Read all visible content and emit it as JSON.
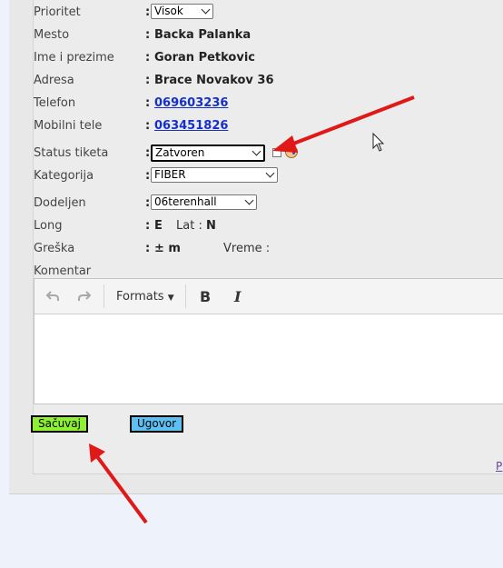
{
  "form": {
    "prioritet": {
      "label": "Prioritet",
      "value": "Visok"
    },
    "mesto": {
      "label": "Mesto",
      "value": "Backa Palanka"
    },
    "ime": {
      "label": "Ime i prezime",
      "value": "Goran Petkovic"
    },
    "adresa": {
      "label": "Adresa",
      "value": "Brace Novakov 36"
    },
    "telefon": {
      "label": "Telefon",
      "value": "069603236"
    },
    "mobilni": {
      "label": "Mobilni tele",
      "value": "063451826"
    },
    "status": {
      "label": "Status tiketa",
      "value": "Zatvoren"
    },
    "kategorija": {
      "label": "Kategorija",
      "value": "FIBER"
    },
    "dodeljen": {
      "label": "Dodeljen",
      "value": "06terenhall"
    },
    "long": {
      "label": "Long",
      "value": "E",
      "lat_label": "Lat :",
      "lat_value": "N"
    },
    "greska": {
      "label": "Greška",
      "value": "± m",
      "vreme_label": "Vreme :"
    },
    "komentar": {
      "label": "Komentar"
    },
    "colon": ":"
  },
  "editor": {
    "undo_icon": "undo-icon",
    "redo_icon": "redo-icon",
    "formats_label": "Formats",
    "bold_label": "B",
    "italic_label": "I"
  },
  "buttons": {
    "save_label": "Sačuvaj",
    "save_color": "#8ef032",
    "contract_label": "Ugovor",
    "contract_color": "#5ec0f2"
  },
  "edge_link": "P",
  "annotation_color": "#e01818"
}
